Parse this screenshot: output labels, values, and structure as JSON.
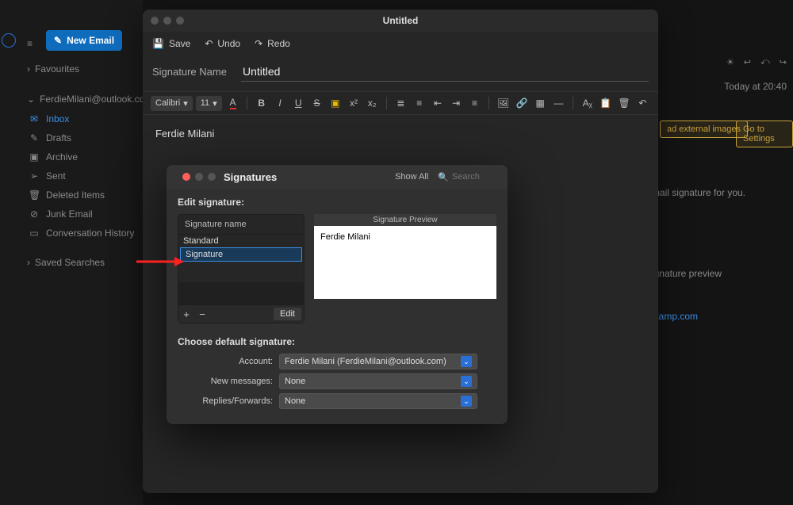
{
  "app": {
    "new_email_label": "New Email",
    "time_label": "Today at 20:40"
  },
  "sidebar": {
    "favourites": "Favourites",
    "account": "FerdieMilani@outlook.co",
    "items": [
      {
        "label": "Inbox"
      },
      {
        "label": "Drafts"
      },
      {
        "label": "Archive"
      },
      {
        "label": "Sent"
      },
      {
        "label": "Deleted Items"
      },
      {
        "label": "Junk Email"
      },
      {
        "label": "Conversation History"
      }
    ],
    "saved_searches": "Saved Searches"
  },
  "background_chips": {
    "external": "ad external images",
    "settings": "Go to Settings"
  },
  "background_text": {
    "sig_for_you": "email signature for you.",
    "sig_preview": "ignature preview",
    "link": "rdstamp.com"
  },
  "editor": {
    "window_title": "Untitled",
    "save": "Save",
    "undo": "Undo",
    "redo": "Redo",
    "sig_name_label": "Signature Name",
    "sig_name_value": "Untitled",
    "font_family": "Calibri",
    "font_size": "11",
    "body_text": "Ferdie Milani"
  },
  "sig_dialog": {
    "title": "Signatures",
    "show_all": "Show All",
    "search_placeholder": "Search",
    "edit_section": "Edit signature:",
    "list_header": "Signature name",
    "items": [
      {
        "name": "Standard"
      },
      {
        "name": "Signature"
      }
    ],
    "edit_btn": "Edit",
    "preview_header": "Signature Preview",
    "preview_body": "Ferdie Milani",
    "defaults_section": "Choose default signature:",
    "account_label": "Account:",
    "account_value": "Ferdie Milani (FerdieMilani@outlook.com)",
    "newmsg_label": "New messages:",
    "newmsg_value": "None",
    "replies_label": "Replies/Forwards:",
    "replies_value": "None"
  }
}
